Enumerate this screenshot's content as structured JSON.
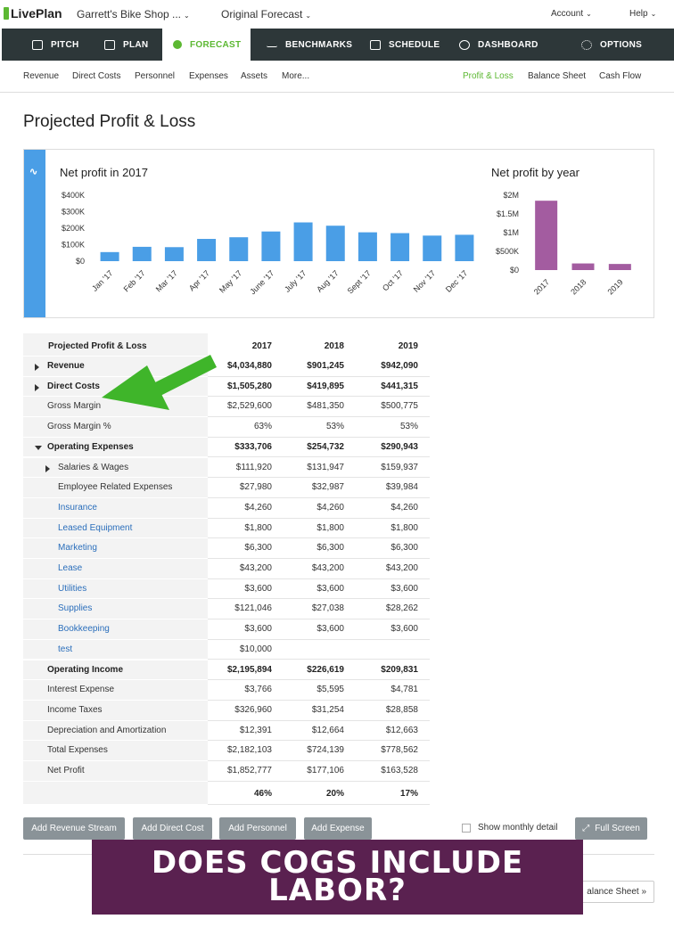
{
  "topbar": {
    "logo": "LivePlan",
    "company": "Garrett's Bike Shop ...",
    "forecast": "Original Forecast",
    "account": "Account",
    "help": "Help"
  },
  "mainnav": {
    "tabs": [
      {
        "label": "PITCH",
        "icon": "monitor-icon"
      },
      {
        "label": "PLAN",
        "icon": "document-icon"
      },
      {
        "label": "FORECAST",
        "icon": "piggy-bank-icon",
        "active": true
      },
      {
        "label": "BENCHMARKS",
        "icon": "trend-line-icon"
      },
      {
        "label": "SCHEDULE",
        "icon": "checklist-icon"
      },
      {
        "label": "DASHBOARD",
        "icon": "gauge-icon"
      },
      {
        "label": "OPTIONS",
        "icon": "gear-icon"
      }
    ]
  },
  "subnav": {
    "left": [
      "Revenue",
      "Direct Costs",
      "Personnel",
      "Expenses",
      "Assets",
      "More..."
    ],
    "right": [
      "Profit & Loss",
      "Balance Sheet",
      "Cash Flow"
    ],
    "active": "Profit & Loss"
  },
  "page": {
    "title": "Projected Profit & Loss"
  },
  "colors": {
    "accent": "#5cb832",
    "nav_bg": "#2d3739",
    "bar_blue": "#4a9ee6",
    "bar_purple": "#a35ca0",
    "banner": "#5a2150",
    "arrow": "#3fb52a"
  },
  "chart_data": [
    {
      "type": "bar",
      "title": "Net profit in 2017",
      "categories": [
        "Jan '17",
        "Feb '17",
        "Mar '17",
        "Apr '17",
        "May '17",
        "June '17",
        "July '17",
        "Aug '17",
        "Sept '17",
        "Oct '17",
        "Nov '17",
        "Dec '17"
      ],
      "values": [
        55000,
        87000,
        85000,
        135000,
        145000,
        180000,
        235000,
        215000,
        175000,
        170000,
        155000,
        160000
      ],
      "yticks": [
        "$0",
        "$100K",
        "$200K",
        "$300K",
        "$400K"
      ],
      "ylim": [
        0,
        400000
      ],
      "color": "#4a9ee6"
    },
    {
      "type": "bar",
      "title": "Net profit by year",
      "categories": [
        "2017",
        "2018",
        "2019"
      ],
      "values": [
        1852777,
        177106,
        163528
      ],
      "yticks": [
        "$0",
        "$500K",
        "$1M",
        "$1.5M",
        "$2M"
      ],
      "ylim": [
        0,
        2000000
      ],
      "color": "#a35ca0"
    }
  ],
  "table": {
    "header": [
      "Projected Profit & Loss",
      "2017",
      "2018",
      "2019"
    ],
    "rows": [
      {
        "label": "Revenue",
        "values": [
          "$4,034,880",
          "$901,245",
          "$942,090"
        ],
        "bold": true,
        "expand": "right",
        "indent": 1
      },
      {
        "label": "Direct Costs",
        "values": [
          "$1,505,280",
          "$419,895",
          "$441,315"
        ],
        "bold": true,
        "expand": "right",
        "indent": 1
      },
      {
        "label": "Gross Margin",
        "values": [
          "$2,529,600",
          "$481,350",
          "$500,775"
        ],
        "indent": 1
      },
      {
        "label": "Gross Margin %",
        "values": [
          "63%",
          "53%",
          "53%"
        ],
        "indent": 1
      },
      {
        "label": "Operating Expenses",
        "values": [
          "$333,706",
          "$254,732",
          "$290,943"
        ],
        "bold": true,
        "expand": "down",
        "indent": 1
      },
      {
        "label": "Salaries & Wages",
        "values": [
          "$111,920",
          "$131,947",
          "$159,937"
        ],
        "expand": "right",
        "indent": 2
      },
      {
        "label": "Employee Related Expenses",
        "values": [
          "$27,980",
          "$32,987",
          "$39,984"
        ],
        "indent": 2
      },
      {
        "label": "Insurance",
        "values": [
          "$4,260",
          "$4,260",
          "$4,260"
        ],
        "link": true,
        "indent": 2
      },
      {
        "label": "Leased Equipment",
        "values": [
          "$1,800",
          "$1,800",
          "$1,800"
        ],
        "link": true,
        "indent": 2
      },
      {
        "label": "Marketing",
        "values": [
          "$6,300",
          "$6,300",
          "$6,300"
        ],
        "link": true,
        "indent": 2
      },
      {
        "label": "Lease",
        "values": [
          "$43,200",
          "$43,200",
          "$43,200"
        ],
        "link": true,
        "indent": 2
      },
      {
        "label": "Utilities",
        "values": [
          "$3,600",
          "$3,600",
          "$3,600"
        ],
        "link": true,
        "indent": 2
      },
      {
        "label": "Supplies",
        "values": [
          "$121,046",
          "$27,038",
          "$28,262"
        ],
        "link": true,
        "indent": 2
      },
      {
        "label": "Bookkeeping",
        "values": [
          "$3,600",
          "$3,600",
          "$3,600"
        ],
        "link": true,
        "indent": 2
      },
      {
        "label": "test",
        "values": [
          "$10,000",
          "",
          ""
        ],
        "link": true,
        "indent": 2
      },
      {
        "label": "Operating Income",
        "values": [
          "$2,195,894",
          "$226,619",
          "$209,831"
        ],
        "bold": true,
        "indent": 1
      },
      {
        "label": "Interest Expense",
        "values": [
          "$3,766",
          "$5,595",
          "$4,781"
        ],
        "indent": 1
      },
      {
        "label": "Income Taxes",
        "values": [
          "$326,960",
          "$31,254",
          "$28,858"
        ],
        "indent": 1
      },
      {
        "label": "Depreciation and Amortization",
        "values": [
          "$12,391",
          "$12,664",
          "$12,663"
        ],
        "indent": 1
      },
      {
        "label": "Total Expenses",
        "values": [
          "$2,182,103",
          "$724,139",
          "$778,562"
        ],
        "indent": 1
      },
      {
        "label": "Net Profit",
        "values": [
          "$1,852,777",
          "$177,106",
          "$163,528"
        ],
        "indent": 1
      },
      {
        "label": "",
        "values": [
          "46%",
          "20%",
          "17%"
        ],
        "bold": true,
        "indent": 1
      }
    ]
  },
  "buttons": {
    "add_revenue": "Add Revenue Stream",
    "add_direct_cost": "Add Direct Cost",
    "add_personnel": "Add Personnel",
    "add_expense": "Add Expense",
    "show_monthly": "Show monthly detail",
    "full_screen": "Full Screen",
    "balance_sheet": "alance Sheet »"
  },
  "banner": {
    "line1": "DOES COGS INCLUDE",
    "line2": "LABOR?"
  }
}
